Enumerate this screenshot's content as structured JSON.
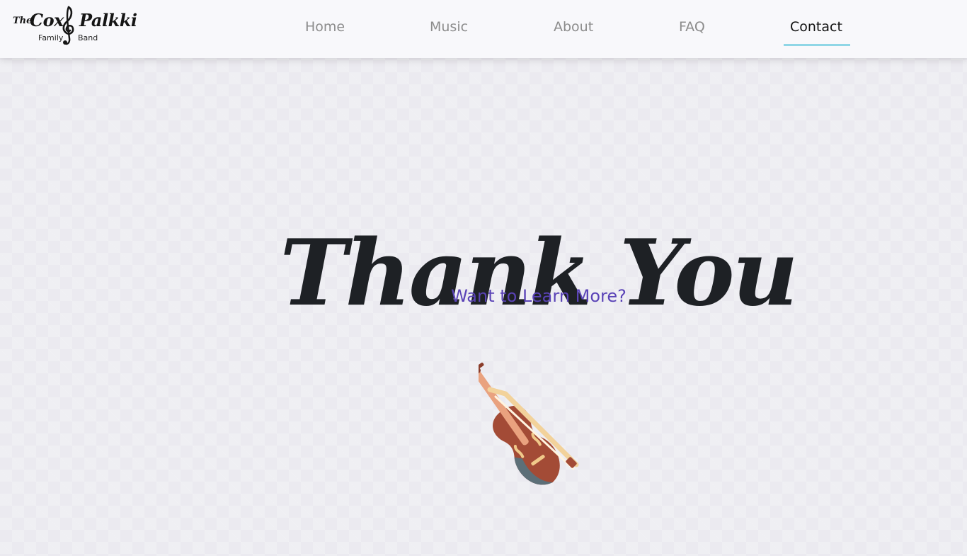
{
  "logo": {
    "the": "The",
    "cox": "Cox",
    "palkki": "Palkki",
    "family": "Family",
    "band": "Band"
  },
  "nav": {
    "items": [
      {
        "label": "Home"
      },
      {
        "label": "Music"
      },
      {
        "label": "About"
      },
      {
        "label": "FAQ"
      },
      {
        "label": "Contact"
      }
    ],
    "active_index": 4
  },
  "hero": {
    "title": "Thank You",
    "link": "Want to Learn More?"
  },
  "icons": {
    "clef": "treble-clef-icon",
    "violin": "violin-icon"
  },
  "colors": {
    "nav_active_underline": "#8fd6e6",
    "link": "#5a43b7",
    "title": "#1e2125",
    "nav_inactive": "#8c8c8c",
    "page_background": "#ebeaf0"
  }
}
